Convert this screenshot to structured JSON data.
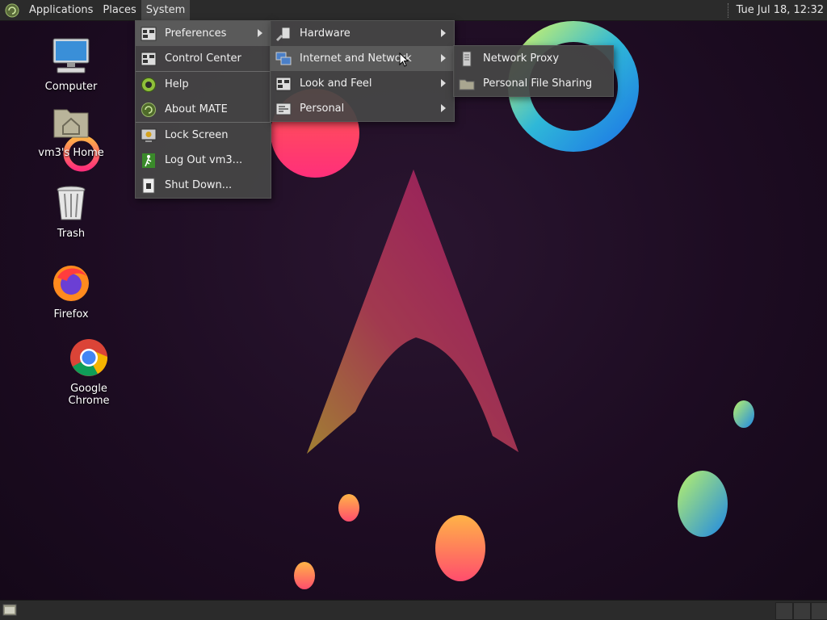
{
  "top_panel": {
    "menus": [
      "Applications",
      "Places",
      "System"
    ],
    "clock": "Tue Jul 18, 12:32"
  },
  "desktop_icons": [
    {
      "label": "Computer",
      "icon": "computer-icon"
    },
    {
      "label": "vm3's Home",
      "icon": "home-folder-icon"
    },
    {
      "label": "Trash",
      "icon": "trash-icon"
    },
    {
      "label": "Firefox",
      "icon": "firefox-icon"
    },
    {
      "label": "Google Chrome",
      "icon": "chrome-icon"
    }
  ],
  "system_menu": {
    "items": [
      {
        "label": "Preferences",
        "icon": "preferences-icon",
        "submenu": true
      },
      {
        "label": "Control Center",
        "icon": "control-center-icon"
      },
      {
        "label": "Help",
        "icon": "help-icon"
      },
      {
        "label": "About MATE",
        "icon": "about-mate-icon"
      },
      {
        "label": "Lock Screen",
        "icon": "lock-screen-icon"
      },
      {
        "label": "Log Out vm3...",
        "icon": "logout-icon"
      },
      {
        "label": "Shut Down...",
        "icon": "shutdown-icon"
      }
    ]
  },
  "preferences_menu": {
    "items": [
      {
        "label": "Hardware",
        "icon": "hardware-icon",
        "submenu": true
      },
      {
        "label": "Internet and Network",
        "icon": "network-icon",
        "submenu": true
      },
      {
        "label": "Look and Feel",
        "icon": "look-feel-icon",
        "submenu": true
      },
      {
        "label": "Personal",
        "icon": "personal-icon",
        "submenu": true
      }
    ]
  },
  "network_menu": {
    "items": [
      {
        "label": "Network Proxy",
        "icon": "network-proxy-icon"
      },
      {
        "label": "Personal File Sharing",
        "icon": "file-sharing-icon"
      }
    ]
  },
  "colors": {
    "panel": "#2b2b2b",
    "menu_bg": "#464646",
    "menu_hover": "#5a5a5a",
    "wallpaper_bg": "#1d0c22"
  }
}
